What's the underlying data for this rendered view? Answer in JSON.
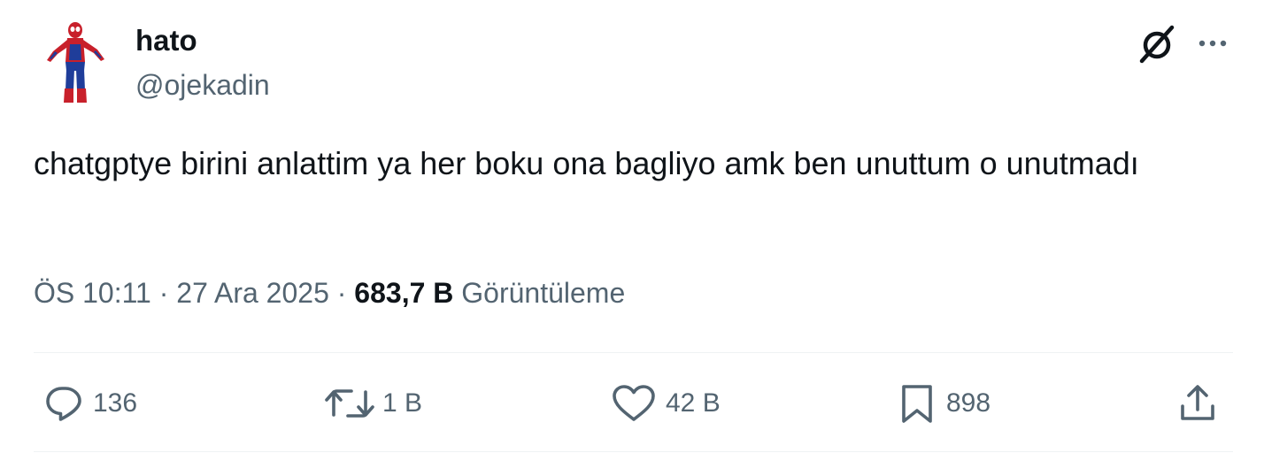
{
  "author": {
    "name": "hato",
    "handle": "@ojekadin",
    "avatar": "spiderman-avatar"
  },
  "header_icons": {
    "grok": "grok-icon",
    "more": "more-options-icon"
  },
  "tweet": {
    "text": "chatgptye birini anlattim ya her boku ona bagliyo amk ben unuttum o unutmadı",
    "time": "ÖS 10:11",
    "separator": "·",
    "date": "27 Ara 2025",
    "views_count": "683,7 B",
    "views_label": "Görüntüleme"
  },
  "actions": {
    "reply": {
      "icon": "reply-icon",
      "count": "136"
    },
    "retweet": {
      "icon": "retweet-icon",
      "count": "1 B"
    },
    "like": {
      "icon": "heart-icon",
      "count": "42 B"
    },
    "bookmark": {
      "icon": "bookmark-icon",
      "count": "898"
    },
    "share": {
      "icon": "share-icon"
    }
  },
  "colors": {
    "text_primary": "#0f1419",
    "text_secondary": "#536471",
    "divider": "#eff3f4"
  }
}
